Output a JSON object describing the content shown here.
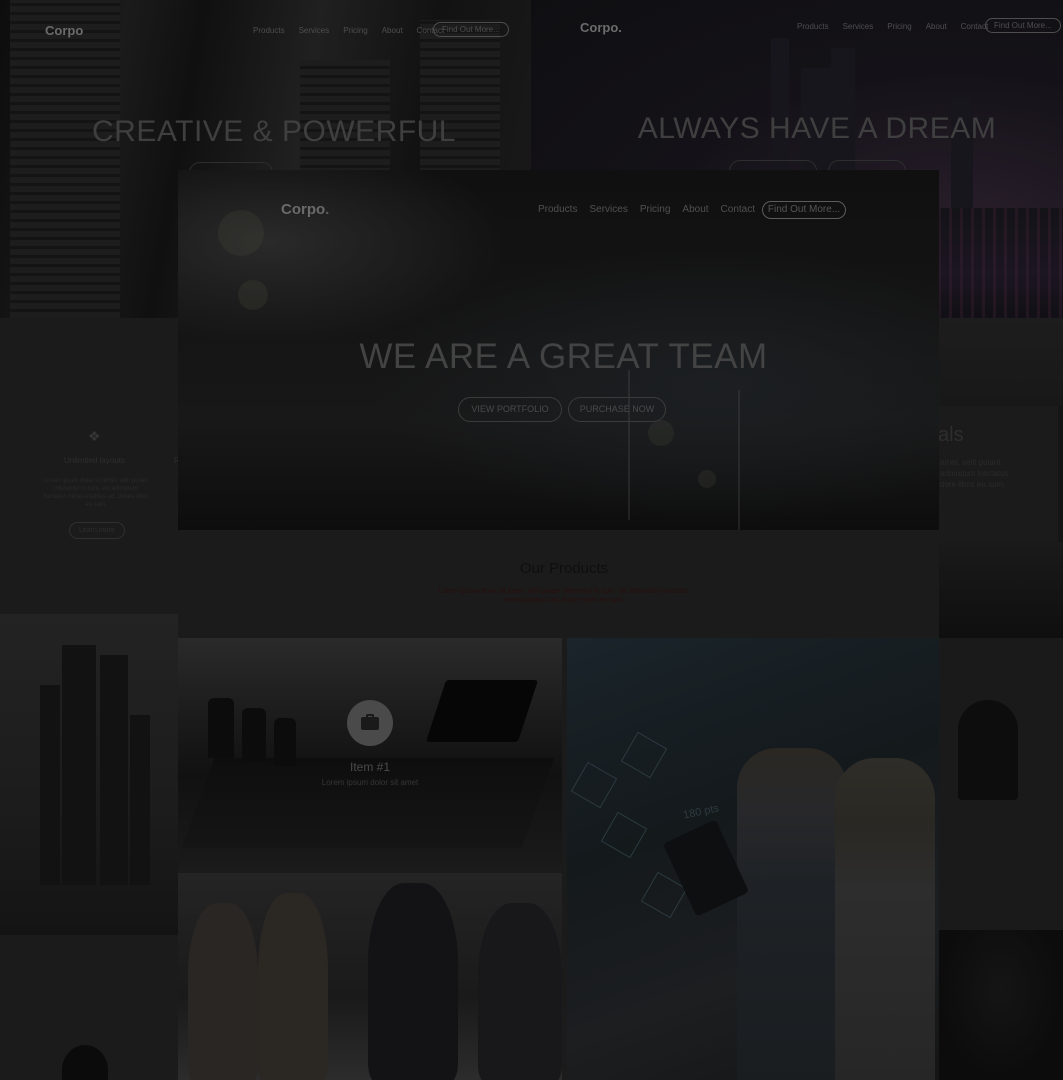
{
  "background_left": {
    "logo": "Corpo",
    "nav": [
      "Products",
      "Services",
      "Pricing",
      "About",
      "Contact"
    ],
    "cta": "Find Out More...",
    "hero_title": "CREATIVE & POWERFUL"
  },
  "background_right": {
    "logo": "Corpo.",
    "nav": [
      "Products",
      "Services",
      "Pricing",
      "About",
      "Contact"
    ],
    "cta": "Find Out More...",
    "hero_title": "ALWAYS HAVE A DREAM"
  },
  "features": {
    "title": "Unlimited layouts",
    "text": "Lorem ipsum dolor sit amet, velit pulant inferentur in cum, vix admodum tractatus necessitatibus ad, dolore libris eu sum.",
    "button": "Learn more",
    "partial_title": "R"
  },
  "deals": {
    "title_fragment": "als",
    "text": "amet, velit pulant admodum tractatus dore libris eu sum."
  },
  "main": {
    "logo": "Corpo",
    "logo_dot": ".",
    "nav": {
      "products": "Products",
      "services": "Services",
      "pricing": "Pricing",
      "about": "About",
      "contact": "Contact"
    },
    "cta": "Find Out More...",
    "hero_title": "WE ARE A GREAT TEAM",
    "btn_portfolio": "VIEW PORTFOLIO",
    "btn_purchase": "PURCHASE NOW",
    "products_title": "Our Products",
    "products_sub": "Lorem ipsum dolor sit amet, velit pulant inferentur in cum, vix admodum tractatus necessitatibus ad, dolore libris eu sum.",
    "item1_title": "Item #1",
    "item1_sub": "Lorem ipsum dolor sit amet",
    "tablet_text": "180 pts",
    "icon": "briefcase-icon"
  },
  "colors": {
    "background": "#151515",
    "panel": "#1b1b1b",
    "muted_text": "#4a4a4a"
  }
}
